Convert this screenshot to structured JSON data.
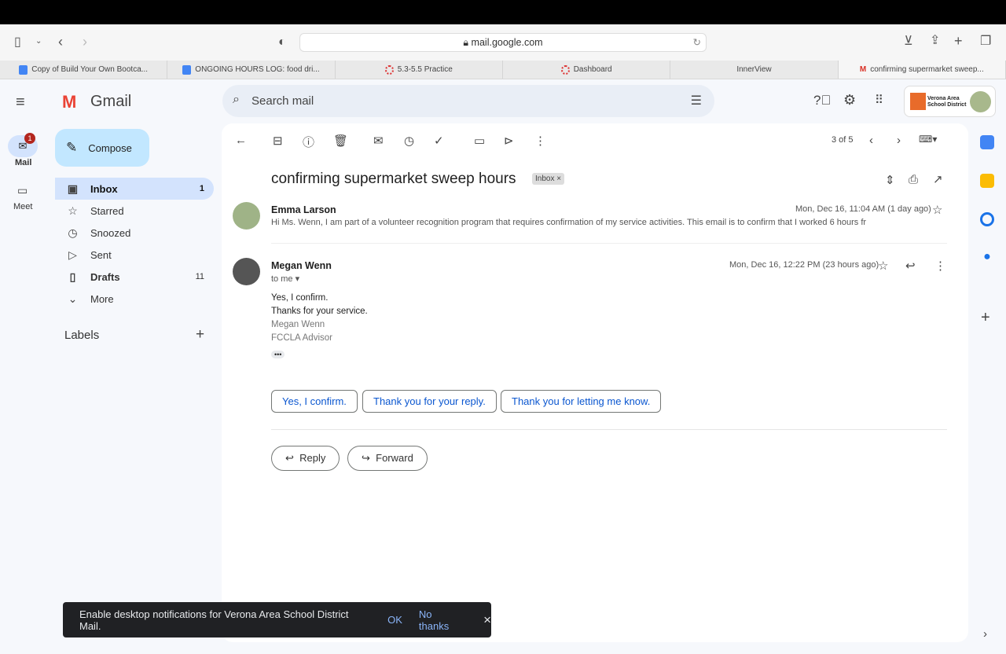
{
  "browser": {
    "url": "mail.google.com",
    "tabs": [
      "Copy of Build Your Own Bootca...",
      "ONGOING HOURS LOG: food dri...",
      "5.3-5.5 Practice",
      "Dashboard",
      "InnerView",
      "confirming supermarket sweep..."
    ]
  },
  "header": {
    "app": "Gmail",
    "search_placeholder": "Search mail",
    "org": "Verona Area School District"
  },
  "rail": {
    "mail": "Mail",
    "mail_badge": "1",
    "meet": "Meet"
  },
  "sidebar": {
    "compose": "Compose",
    "items": [
      {
        "label": "Inbox",
        "count": "1"
      },
      {
        "label": "Starred",
        "count": ""
      },
      {
        "label": "Snoozed",
        "count": ""
      },
      {
        "label": "Sent",
        "count": ""
      },
      {
        "label": "Drafts",
        "count": "11"
      },
      {
        "label": "More",
        "count": ""
      }
    ],
    "labels": "Labels"
  },
  "toolbar": {
    "pager": "3 of 5"
  },
  "thread": {
    "subject": "confirming supermarket sweep hours",
    "label": "Inbox",
    "messages": [
      {
        "sender": "Emma Larson",
        "date": "Mon, Dec 16, 11:04 AM (1 day ago)",
        "snippet": "Hi Ms. Wenn, I am part of a volunteer recognition program that requires confirmation of my service activities. This email is to confirm that I worked 6 hours fr"
      },
      {
        "sender": "Megan Wenn",
        "to": "to me",
        "date": "Mon, Dec 16, 12:22 PM (23 hours ago)",
        "body": [
          "Yes, I confirm.",
          "Thanks for your service."
        ],
        "signature": [
          "Megan Wenn",
          "FCCLA Advisor"
        ]
      }
    ],
    "smart_replies": [
      "Yes, I confirm.",
      "Thank you for your reply.",
      "Thank you for letting me know."
    ],
    "reply": "Reply",
    "forward": "Forward"
  },
  "snackbar": {
    "text": "Enable desktop notifications for Verona Area School District Mail.",
    "ok": "OK",
    "no": "No thanks"
  }
}
